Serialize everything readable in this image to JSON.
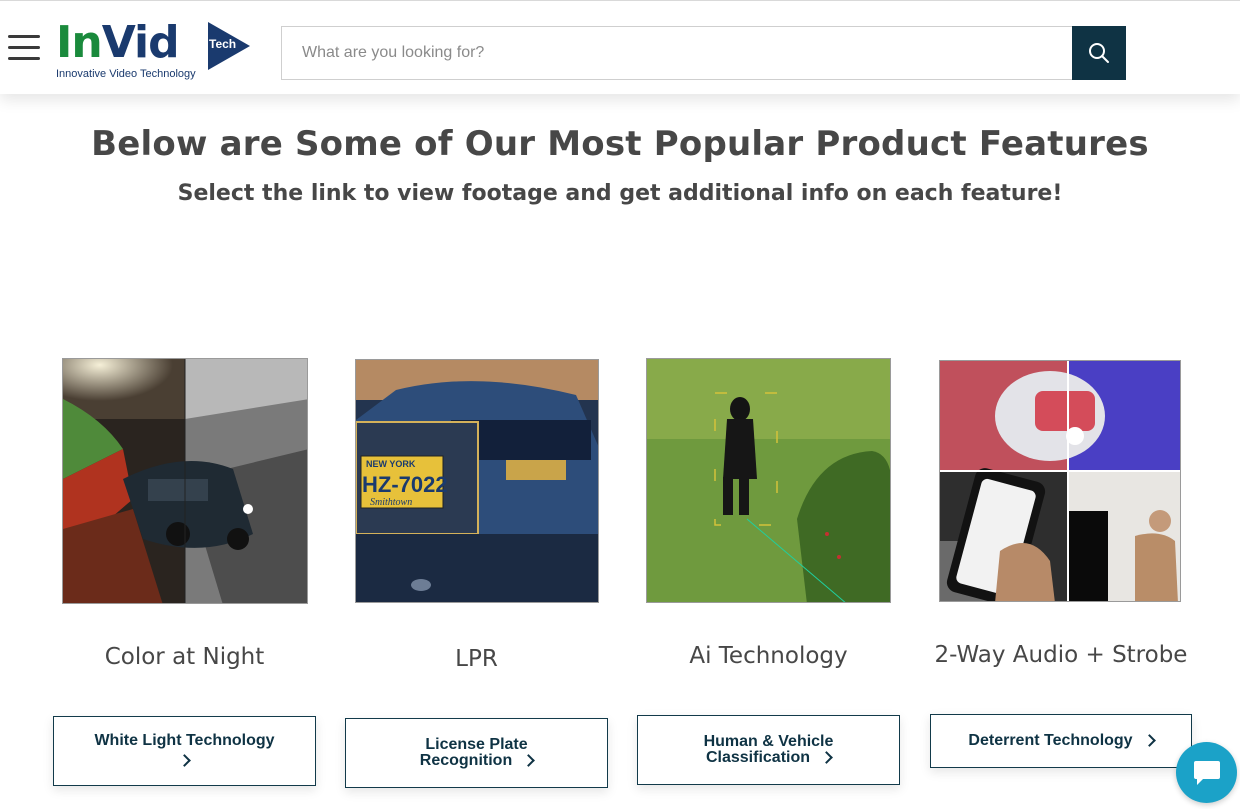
{
  "header": {
    "logo": {
      "brand_part1": "In",
      "brand_part2": "Vid",
      "brand_tech": "Tech",
      "tagline": "Innovative Video Technology"
    },
    "search": {
      "placeholder": "What are you looking for?",
      "value": "",
      "button_icon": "search-icon"
    },
    "menu_icon": "hamburger-menu-icon"
  },
  "main": {
    "title": "Below are Some of Our Most Popular Product Features",
    "subtitle": "Select the link to view footage and get additional info on each feature!"
  },
  "features": [
    {
      "name": "Color at Night",
      "button_line1": "White Light Technology",
      "button_line2": ""
    },
    {
      "name": "LPR",
      "button_line1": "License Plate",
      "button_line2": "Recognition"
    },
    {
      "name": "Ai Technology",
      "button_line1": "Human & Vehicle",
      "button_line2": "Classification"
    },
    {
      "name": "2-Way Audio + Strobe",
      "button_line1": "Deterrent Technology",
      "button_line2": ""
    }
  ],
  "plate_text": {
    "state": "NEW YORK",
    "number": "HZ-7022",
    "county": "Smithtown"
  },
  "chat": {
    "icon": "chat-bubble-icon"
  },
  "colors": {
    "brand_green": "#1a8a3c",
    "brand_navy": "#1a3a6e",
    "button_navy": "#0f3344",
    "chat_blue": "#1ba2c8",
    "heading_gray": "#474747"
  }
}
